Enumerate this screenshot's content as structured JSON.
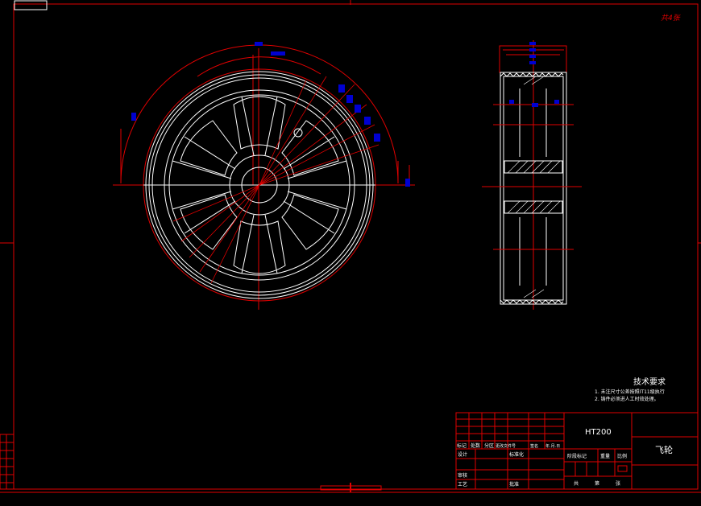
{
  "drawing": {
    "corner_mark": "共4张",
    "tech_requirements": {
      "title": "技术要求",
      "items": [
        "1. 未注尺寸公差按照IT11级执行",
        "2. 铸件必须进人工时效处理。"
      ]
    },
    "title_block": {
      "material": "HT200",
      "part_name": "飞轮",
      "headers": {
        "mark": "标记",
        "count": "处数",
        "zone": "分区",
        "change_doc": "更改文件号",
        "signature": "签名",
        "date": "年.月.日"
      },
      "design": "设计",
      "standardization": "标准化",
      "stage_mark": "阶段标记",
      "weight": "重量",
      "scale": "比例",
      "review": "审核",
      "process": "工艺",
      "approve": "批准",
      "total": "共",
      "sheet": "第",
      "sheets": "张"
    }
  },
  "colors": {
    "background": "#000000",
    "line": "#ffffff",
    "dimension": "#e00000",
    "text_marker": "#0000d0"
  }
}
